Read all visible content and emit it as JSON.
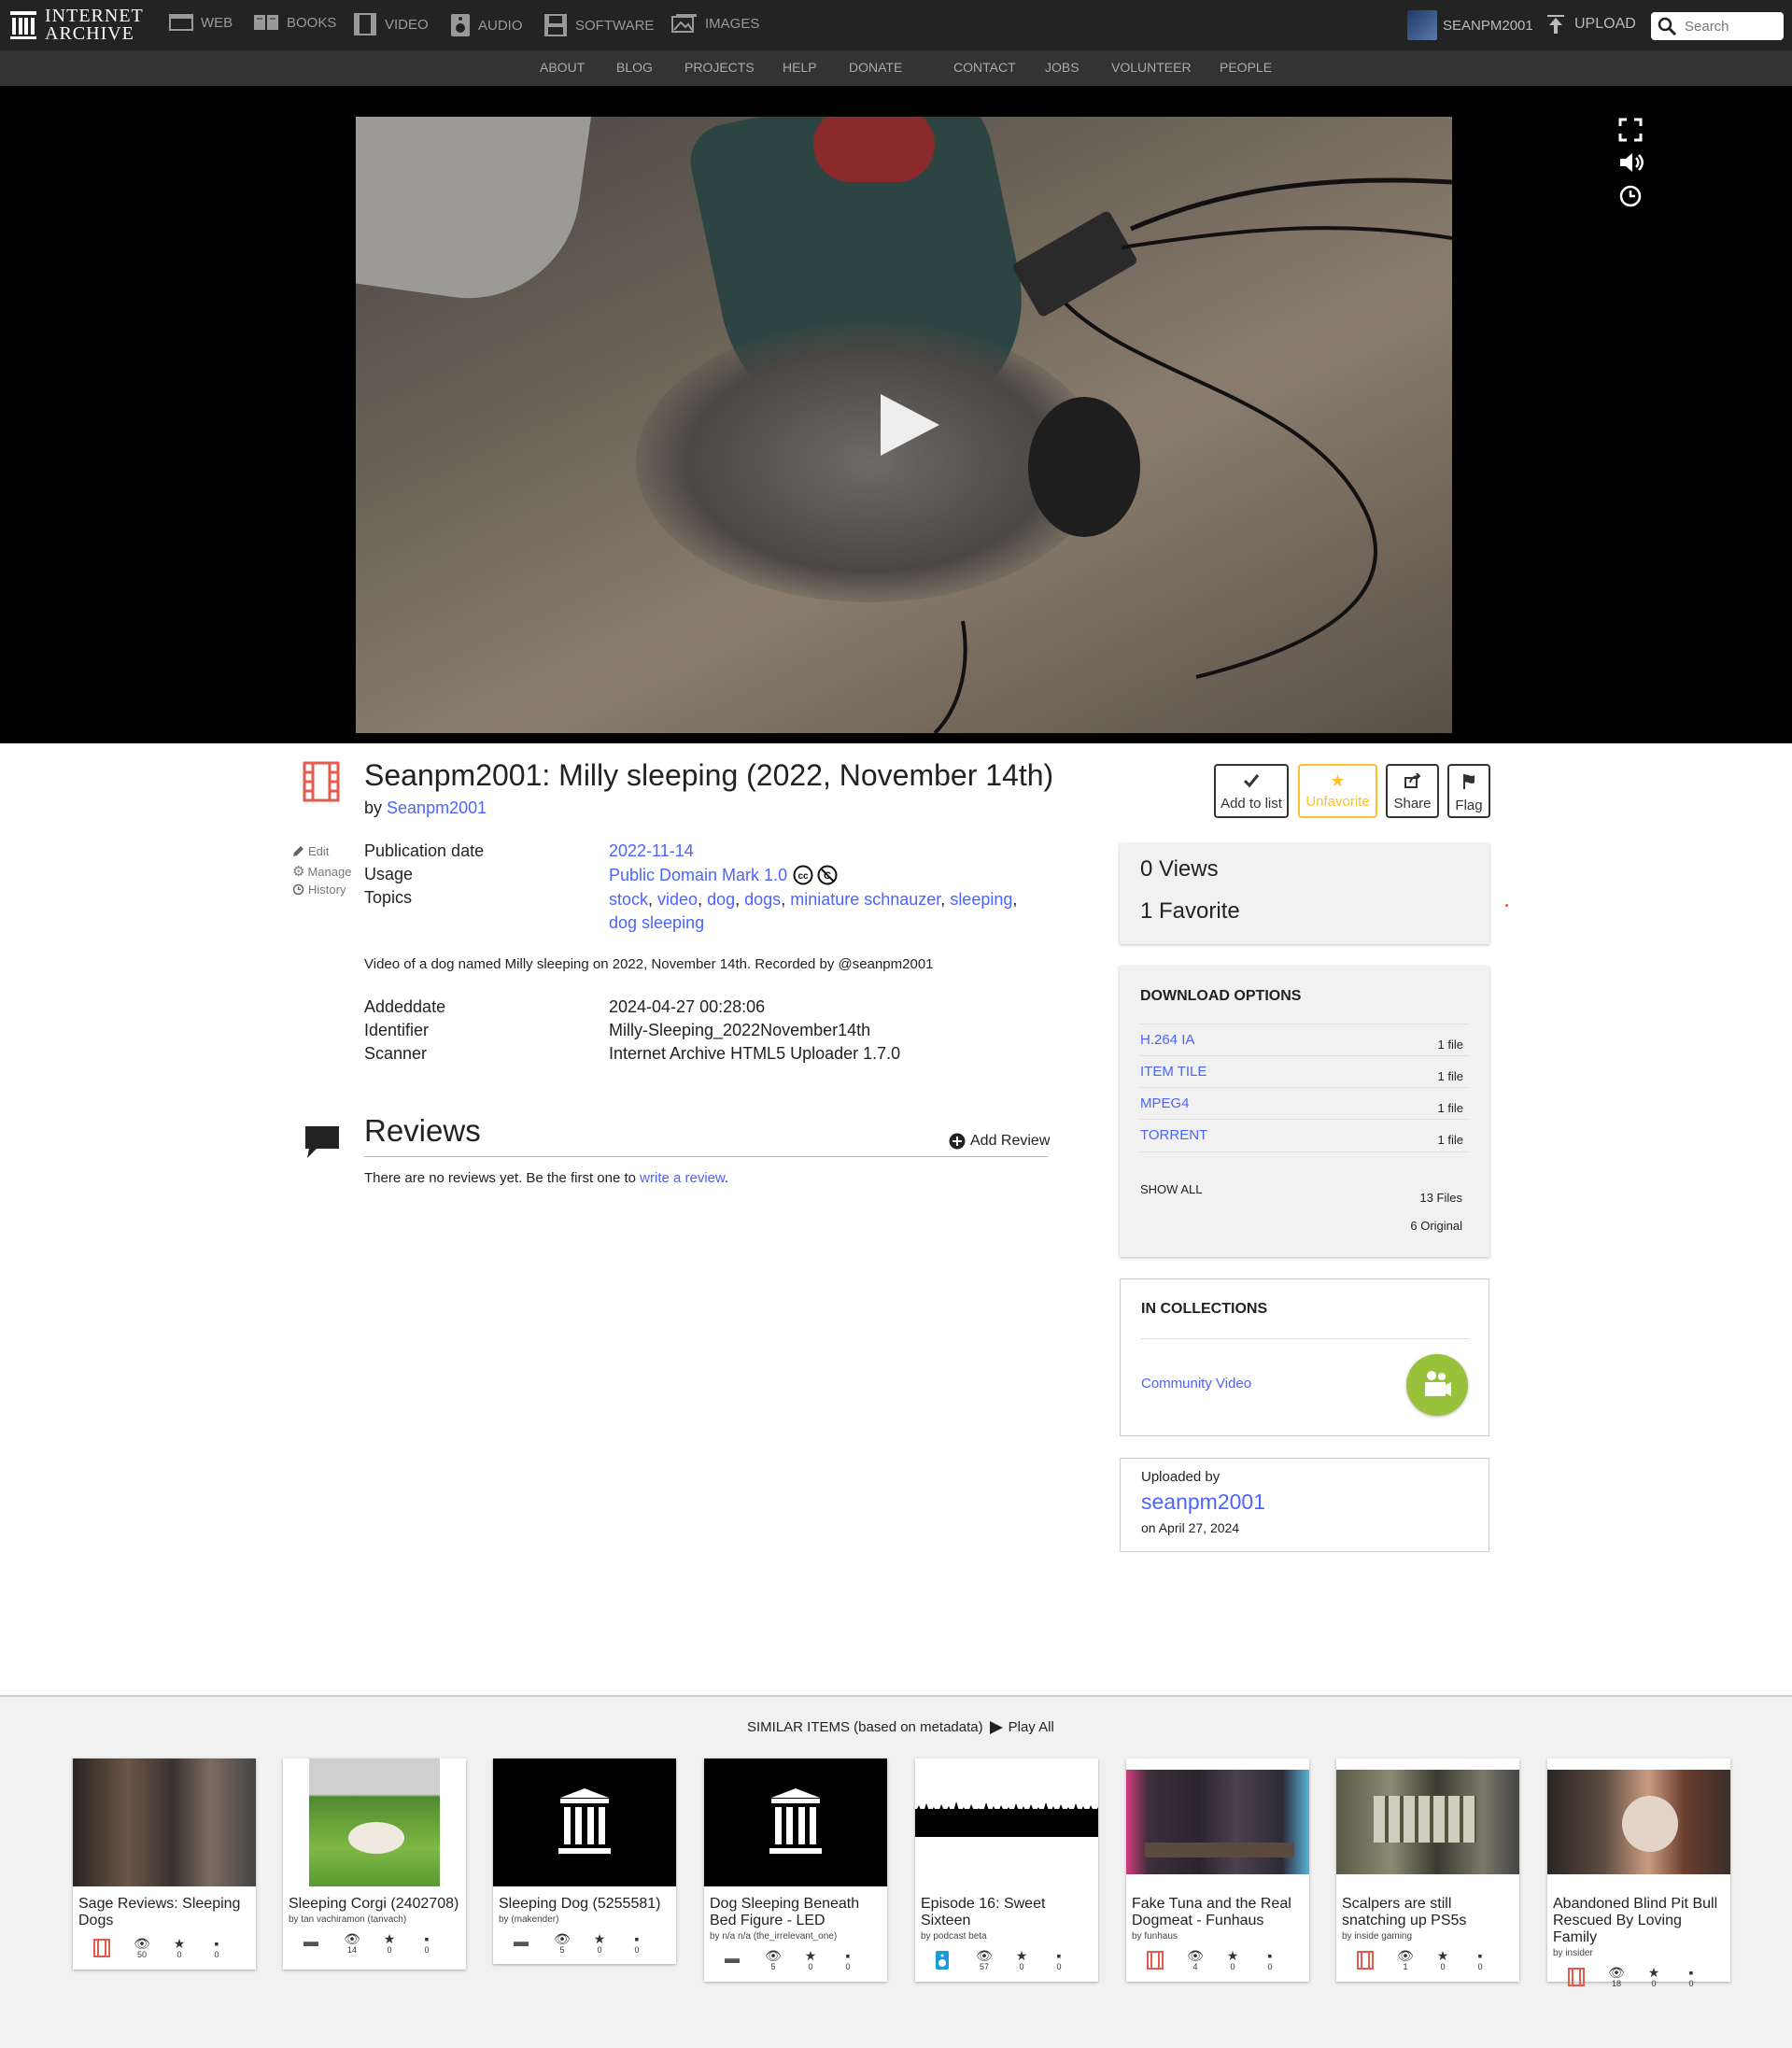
{
  "nav": {
    "logo_line1": "INTERNET",
    "logo_line2": "ARCHIVE",
    "mediatypes": [
      {
        "label": "WEB",
        "icon": "web-icon"
      },
      {
        "label": "BOOKS",
        "icon": "books-icon"
      },
      {
        "label": "VIDEO",
        "icon": "video-icon"
      },
      {
        "label": "AUDIO",
        "icon": "audio-icon"
      },
      {
        "label": "SOFTWARE",
        "icon": "software-icon"
      },
      {
        "label": "IMAGES",
        "icon": "images-icon"
      }
    ],
    "username": "SEANPM2001",
    "upload": "UPLOAD",
    "search_placeholder": "Search"
  },
  "subnav": [
    "ABOUT",
    "BLOG",
    "PROJECTS",
    "HELP",
    "DONATE",
    "CONTACT",
    "JOBS",
    "VOLUNTEER",
    "PEOPLE"
  ],
  "item": {
    "title": "Seanpm2001: Milly sleeping (2022, November 14th)",
    "by_prefix": "by",
    "creator": "Seanpm2001",
    "actions": {
      "add_to_list": "Add to list",
      "unfavorite": "Unfavorite",
      "share": "Share",
      "flag": "Flag"
    },
    "side_links": {
      "edit": "Edit",
      "manage": "Manage",
      "history": "History"
    },
    "metadata": {
      "publication_date_label": "Publication date",
      "publication_date": "2022-11-14",
      "usage_label": "Usage",
      "usage": "Public Domain Mark 1.0",
      "topics_label": "Topics",
      "topics": [
        "stock",
        "video",
        "dog",
        "dogs",
        "miniature schnauzer",
        "sleeping",
        "dog sleeping"
      ],
      "description": "Video of a dog named Milly sleeping on 2022, November 14th. Recorded by @seanpm2001",
      "addeddate_label": "Addeddate",
      "addeddate": "2024-04-27 00:28:06",
      "identifier_label": "Identifier",
      "identifier": "Milly-Sleeping_2022November14th",
      "scanner_label": "Scanner",
      "scanner": "Internet Archive HTML5 Uploader 1.7.0"
    }
  },
  "reviews": {
    "heading": "Reviews",
    "add_review": "Add Review",
    "empty_text": "There are no reviews yet. Be the first one to",
    "empty_link": "write a review",
    "empty_end": "."
  },
  "stats": {
    "views": "0 Views",
    "favorites": "1 Favorite"
  },
  "downloads": {
    "heading": "DOWNLOAD OPTIONS",
    "formats": [
      {
        "name": "H.264 IA",
        "count": "1 file"
      },
      {
        "name": "ITEM TILE",
        "count": "1 file"
      },
      {
        "name": "MPEG4",
        "count": "1 file"
      },
      {
        "name": "TORRENT",
        "count": "1 file"
      }
    ],
    "show_all": "SHOW ALL",
    "total_files": "13 Files",
    "original_files": "6 Original"
  },
  "collections": {
    "heading": "IN COLLECTIONS",
    "items": [
      "Community Video"
    ]
  },
  "uploader": {
    "label": "Uploaded by",
    "name": "seanpm2001",
    "date": "on April 27, 2024"
  },
  "similar": {
    "heading": "SIMILAR ITEMS (based on metadata)",
    "play_all": "Play All",
    "items": [
      {
        "title": "Sage Reviews: Sleeping Dogs",
        "by": "",
        "views": "50",
        "favs": "0",
        "reviews": "0"
      },
      {
        "title": "Sleeping Corgi (2402708)",
        "by": "by tan vachiramon (tanvach)",
        "views": "14",
        "favs": "0",
        "reviews": "0"
      },
      {
        "title": "Sleeping Dog (5255581)",
        "by": "by (makender)",
        "views": "5",
        "favs": "0",
        "reviews": "0"
      },
      {
        "title": "Dog Sleeping Beneath Bed Figure - LED",
        "by": "by n/a n/a (the_irrelevant_one)",
        "views": "5",
        "favs": "0",
        "reviews": "0"
      },
      {
        "title": "Episode 16: Sweet Sixteen",
        "by": "by podcast beta",
        "views": "57",
        "favs": "0",
        "reviews": "0"
      },
      {
        "title": "Fake Tuna and the Real Dogmeat - Funhaus",
        "by": "by funhaus",
        "views": "4",
        "favs": "0",
        "reviews": "0"
      },
      {
        "title": "Scalpers are still snatching up PS5s",
        "by": "by inside gaming",
        "views": "1",
        "favs": "0",
        "reviews": "0"
      },
      {
        "title": "Abandoned Blind Pit Bull Rescued By Loving Family",
        "by": "by insider",
        "views": "18",
        "favs": "0",
        "reviews": "0"
      }
    ]
  },
  "colors": {
    "accent": "#4b64ff",
    "favorite": "#fbc02d",
    "video_type": "#e35b4c",
    "donate_heart": "#e52b2b",
    "collection_badge": "#9ac13c"
  }
}
